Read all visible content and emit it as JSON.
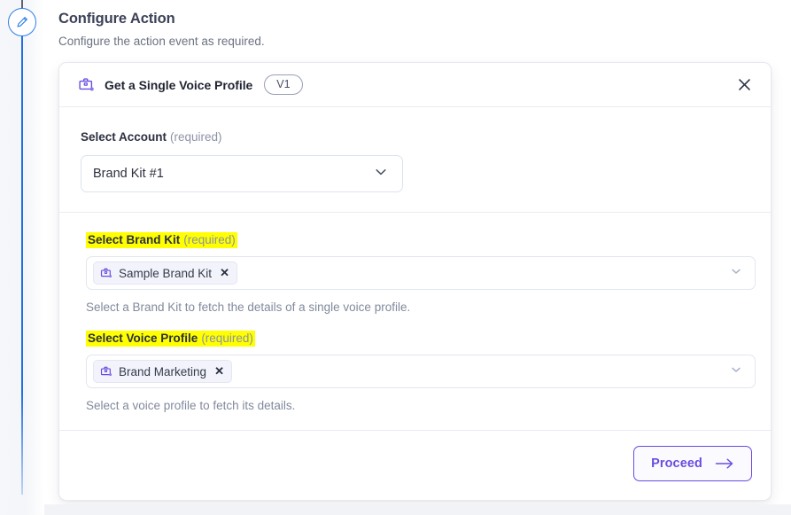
{
  "rail": {
    "node_icon": "pencil-edit-icon"
  },
  "header": {
    "title": "Configure Action",
    "subtitle": "Configure the action event as required."
  },
  "card": {
    "head": {
      "icon": "briefcase-icon",
      "title": "Get a Single Voice Profile",
      "version_badge": "V1",
      "close_icon": "close-icon"
    },
    "account_section": {
      "label": "Select Account",
      "required_note": "(required)",
      "selected_value": "Brand Kit #1",
      "chevron_icon": "chevron-down-icon"
    },
    "brand_kit_section": {
      "label": "Select Brand Kit",
      "required_note": "(required)",
      "highlighted": true,
      "chip": {
        "icon": "briefcase-icon",
        "label": "Sample Brand Kit",
        "remove_icon": "close-small-icon"
      },
      "help_text": "Select a Brand Kit to fetch the details of a single voice profile.",
      "chevron_icon": "chevron-down-icon"
    },
    "voice_profile_section": {
      "label": "Select Voice Profile",
      "required_note": "(required)",
      "highlighted": true,
      "chip": {
        "icon": "briefcase-icon",
        "label": "Brand Marketing",
        "remove_icon": "close-small-icon"
      },
      "help_text": "Select a voice profile to fetch its details.",
      "chevron_icon": "chevron-down-icon"
    },
    "footer": {
      "proceed_label": "Proceed",
      "proceed_arrow_icon": "arrow-right-icon"
    }
  },
  "colors": {
    "accent_purple": "#6a4de0",
    "rail_blue": "#1f6fe0",
    "highlight_yellow": "#ffff00",
    "text_primary": "#2b3040",
    "text_muted": "#818a9c",
    "border": "#e6e9ef"
  }
}
